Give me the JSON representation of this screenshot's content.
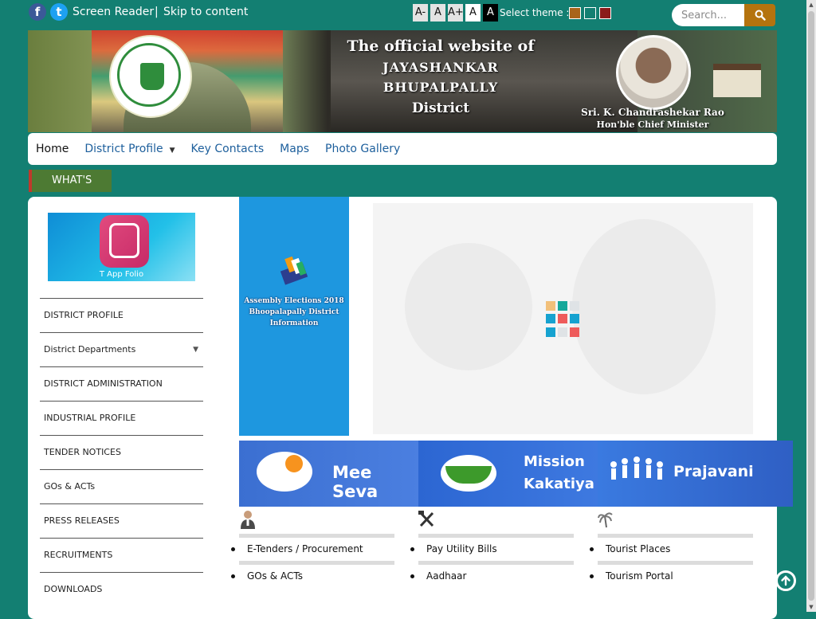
{
  "topbar": {
    "social": [
      {
        "name": "facebook-icon",
        "glyph": "f"
      },
      {
        "name": "twitter-icon",
        "glyph": "t"
      }
    ],
    "screen_reader": "Screen Reader",
    "separator": "|",
    "skip": "Skip to content",
    "font_sizes": [
      "A-",
      "A",
      "A+",
      "A",
      "A"
    ],
    "theme_label": "Select theme :",
    "themes": [
      "#a8641a",
      "#137f72",
      "#8b1a1a"
    ],
    "search_placeholder": "Search..."
  },
  "banner": {
    "title_l1": "The official website of",
    "title_l2": "JAYASHANKAR BHUPALPALLY",
    "title_l3": "District",
    "cm_name": "Sri. K. Chandrashekar Rao",
    "cm_role": "Hon'ble Chief Minister"
  },
  "nav": {
    "items": [
      "Home",
      "District Profile",
      "Key Contacts",
      "Maps",
      "Photo Gallery"
    ]
  },
  "whats": "WHAT'S",
  "tapp": {
    "label": "T App Folio"
  },
  "side_menu": [
    "DISTRICT PROFILE",
    "District Departments",
    "DISTRICT ADMINISTRATION",
    "INDUSTRIAL PROFILE",
    "TENDER NOTICES",
    "GOs & ACTs",
    "PRESS RELEASES",
    "RECRUITMENTS",
    "DOWNLOADS"
  ],
  "election": {
    "l1": "Assembly Elections 2018",
    "l2": "Bhoopalapally District",
    "l3": "Information"
  },
  "loader_colors": [
    "#f2c07a",
    "#17a89a",
    "#dfe3e6",
    "#16a2d0",
    "#ee5b5b",
    "#16a2d0",
    "#16a2d0",
    "#dfe3e6",
    "#ee5b5b"
  ],
  "banners": {
    "meeseva": "Mee Seva",
    "mission_l1": "Mission",
    "mission_l2": "Kakatiya",
    "prajavani": "Prajavani"
  },
  "columns": [
    {
      "icon": "citizen-icon",
      "items": [
        "E-Tenders / Procurement",
        "GOs & ACTs"
      ]
    },
    {
      "icon": "tools-icon",
      "items": [
        "Pay Utility Bills",
        "Aadhaar"
      ]
    },
    {
      "icon": "tourism-icon",
      "items": [
        "Tourist Places",
        "Tourism Portal"
      ]
    }
  ]
}
